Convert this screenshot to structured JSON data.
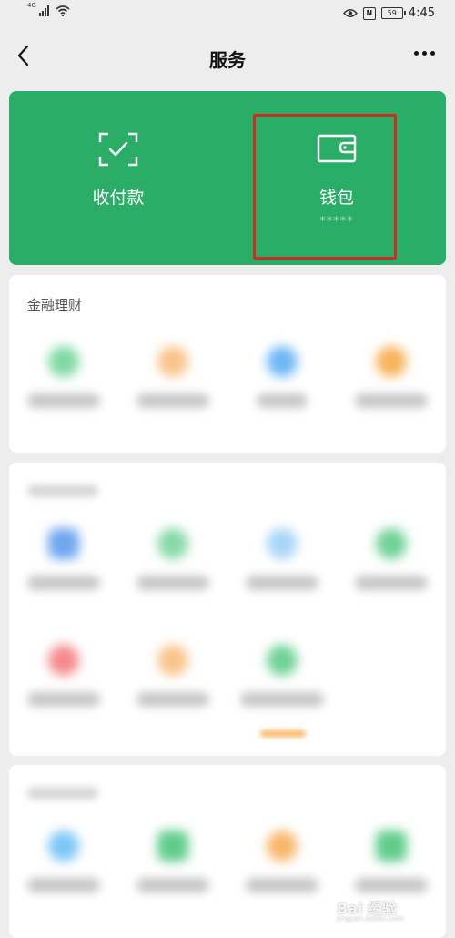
{
  "status_bar": {
    "network": "4G",
    "battery": "59",
    "time": "4:45",
    "icons": [
      "signal-icon",
      "wifi-icon",
      "eye-icon",
      "nfc-icon",
      "battery-icon"
    ]
  },
  "nav": {
    "title": "服务",
    "back_icon": "chevron-left-icon",
    "more_icon": "more-dots-icon"
  },
  "top_card": {
    "background": "#2aae67",
    "items": [
      {
        "label": "收付款",
        "icon": "scan-check-icon"
      },
      {
        "label": "钱包",
        "sub": "*****",
        "icon": "wallet-icon"
      }
    ],
    "highlight_color": "#d42a1f"
  },
  "sections": [
    {
      "title": "金融理财",
      "items": [
        {
          "icon_color": "#7fd9a2"
        },
        {
          "icon_color": "#f9c48c"
        },
        {
          "icon_color": "#6fb7f5"
        },
        {
          "icon_color": "#f7b35a"
        }
      ]
    },
    {
      "title": "",
      "items": [
        {
          "icon_color": "#6fa6ee"
        },
        {
          "icon_color": "#86d9a7"
        },
        {
          "icon_color": "#a8d6f7"
        },
        {
          "icon_color": "#6fd296"
        },
        {
          "icon_color": "#f58a8a"
        },
        {
          "icon_color": "#f9c48c"
        },
        {
          "icon_color": "#6fd296"
        }
      ]
    },
    {
      "title": "",
      "items": [
        {
          "icon_color": "#7cc7f5"
        },
        {
          "icon_color": "#5fcc8a"
        },
        {
          "icon_color": "#f7b76a"
        },
        {
          "icon_color": "#5fcc8a"
        }
      ]
    }
  ],
  "watermark": {
    "text": "Bai 经验",
    "sub": "jingyan.baidu.com"
  }
}
